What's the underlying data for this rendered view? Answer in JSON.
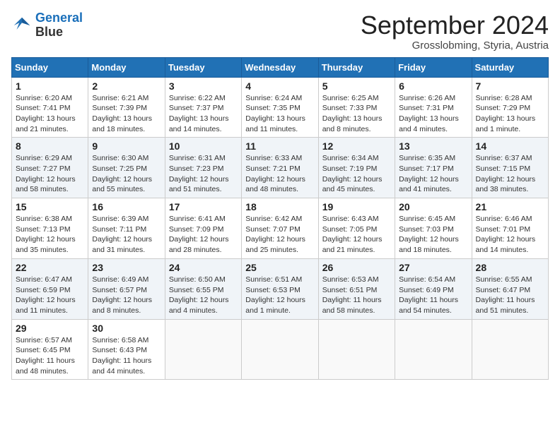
{
  "header": {
    "logo_line1": "General",
    "logo_line2": "Blue",
    "month": "September 2024",
    "location": "Grosslobming, Styria, Austria"
  },
  "weekdays": [
    "Sunday",
    "Monday",
    "Tuesday",
    "Wednesday",
    "Thursday",
    "Friday",
    "Saturday"
  ],
  "weeks": [
    [
      {
        "day": "1",
        "sunrise": "Sunrise: 6:20 AM",
        "sunset": "Sunset: 7:41 PM",
        "daylight": "Daylight: 13 hours and 21 minutes."
      },
      {
        "day": "2",
        "sunrise": "Sunrise: 6:21 AM",
        "sunset": "Sunset: 7:39 PM",
        "daylight": "Daylight: 13 hours and 18 minutes."
      },
      {
        "day": "3",
        "sunrise": "Sunrise: 6:22 AM",
        "sunset": "Sunset: 7:37 PM",
        "daylight": "Daylight: 13 hours and 14 minutes."
      },
      {
        "day": "4",
        "sunrise": "Sunrise: 6:24 AM",
        "sunset": "Sunset: 7:35 PM",
        "daylight": "Daylight: 13 hours and 11 minutes."
      },
      {
        "day": "5",
        "sunrise": "Sunrise: 6:25 AM",
        "sunset": "Sunset: 7:33 PM",
        "daylight": "Daylight: 13 hours and 8 minutes."
      },
      {
        "day": "6",
        "sunrise": "Sunrise: 6:26 AM",
        "sunset": "Sunset: 7:31 PM",
        "daylight": "Daylight: 13 hours and 4 minutes."
      },
      {
        "day": "7",
        "sunrise": "Sunrise: 6:28 AM",
        "sunset": "Sunset: 7:29 PM",
        "daylight": "Daylight: 13 hours and 1 minute."
      }
    ],
    [
      {
        "day": "8",
        "sunrise": "Sunrise: 6:29 AM",
        "sunset": "Sunset: 7:27 PM",
        "daylight": "Daylight: 12 hours and 58 minutes."
      },
      {
        "day": "9",
        "sunrise": "Sunrise: 6:30 AM",
        "sunset": "Sunset: 7:25 PM",
        "daylight": "Daylight: 12 hours and 55 minutes."
      },
      {
        "day": "10",
        "sunrise": "Sunrise: 6:31 AM",
        "sunset": "Sunset: 7:23 PM",
        "daylight": "Daylight: 12 hours and 51 minutes."
      },
      {
        "day": "11",
        "sunrise": "Sunrise: 6:33 AM",
        "sunset": "Sunset: 7:21 PM",
        "daylight": "Daylight: 12 hours and 48 minutes."
      },
      {
        "day": "12",
        "sunrise": "Sunrise: 6:34 AM",
        "sunset": "Sunset: 7:19 PM",
        "daylight": "Daylight: 12 hours and 45 minutes."
      },
      {
        "day": "13",
        "sunrise": "Sunrise: 6:35 AM",
        "sunset": "Sunset: 7:17 PM",
        "daylight": "Daylight: 12 hours and 41 minutes."
      },
      {
        "day": "14",
        "sunrise": "Sunrise: 6:37 AM",
        "sunset": "Sunset: 7:15 PM",
        "daylight": "Daylight: 12 hours and 38 minutes."
      }
    ],
    [
      {
        "day": "15",
        "sunrise": "Sunrise: 6:38 AM",
        "sunset": "Sunset: 7:13 PM",
        "daylight": "Daylight: 12 hours and 35 minutes."
      },
      {
        "day": "16",
        "sunrise": "Sunrise: 6:39 AM",
        "sunset": "Sunset: 7:11 PM",
        "daylight": "Daylight: 12 hours and 31 minutes."
      },
      {
        "day": "17",
        "sunrise": "Sunrise: 6:41 AM",
        "sunset": "Sunset: 7:09 PM",
        "daylight": "Daylight: 12 hours and 28 minutes."
      },
      {
        "day": "18",
        "sunrise": "Sunrise: 6:42 AM",
        "sunset": "Sunset: 7:07 PM",
        "daylight": "Daylight: 12 hours and 25 minutes."
      },
      {
        "day": "19",
        "sunrise": "Sunrise: 6:43 AM",
        "sunset": "Sunset: 7:05 PM",
        "daylight": "Daylight: 12 hours and 21 minutes."
      },
      {
        "day": "20",
        "sunrise": "Sunrise: 6:45 AM",
        "sunset": "Sunset: 7:03 PM",
        "daylight": "Daylight: 12 hours and 18 minutes."
      },
      {
        "day": "21",
        "sunrise": "Sunrise: 6:46 AM",
        "sunset": "Sunset: 7:01 PM",
        "daylight": "Daylight: 12 hours and 14 minutes."
      }
    ],
    [
      {
        "day": "22",
        "sunrise": "Sunrise: 6:47 AM",
        "sunset": "Sunset: 6:59 PM",
        "daylight": "Daylight: 12 hours and 11 minutes."
      },
      {
        "day": "23",
        "sunrise": "Sunrise: 6:49 AM",
        "sunset": "Sunset: 6:57 PM",
        "daylight": "Daylight: 12 hours and 8 minutes."
      },
      {
        "day": "24",
        "sunrise": "Sunrise: 6:50 AM",
        "sunset": "Sunset: 6:55 PM",
        "daylight": "Daylight: 12 hours and 4 minutes."
      },
      {
        "day": "25",
        "sunrise": "Sunrise: 6:51 AM",
        "sunset": "Sunset: 6:53 PM",
        "daylight": "Daylight: 12 hours and 1 minute."
      },
      {
        "day": "26",
        "sunrise": "Sunrise: 6:53 AM",
        "sunset": "Sunset: 6:51 PM",
        "daylight": "Daylight: 11 hours and 58 minutes."
      },
      {
        "day": "27",
        "sunrise": "Sunrise: 6:54 AM",
        "sunset": "Sunset: 6:49 PM",
        "daylight": "Daylight: 11 hours and 54 minutes."
      },
      {
        "day": "28",
        "sunrise": "Sunrise: 6:55 AM",
        "sunset": "Sunset: 6:47 PM",
        "daylight": "Daylight: 11 hours and 51 minutes."
      }
    ],
    [
      {
        "day": "29",
        "sunrise": "Sunrise: 6:57 AM",
        "sunset": "Sunset: 6:45 PM",
        "daylight": "Daylight: 11 hours and 48 minutes."
      },
      {
        "day": "30",
        "sunrise": "Sunrise: 6:58 AM",
        "sunset": "Sunset: 6:43 PM",
        "daylight": "Daylight: 11 hours and 44 minutes."
      },
      null,
      null,
      null,
      null,
      null
    ]
  ]
}
